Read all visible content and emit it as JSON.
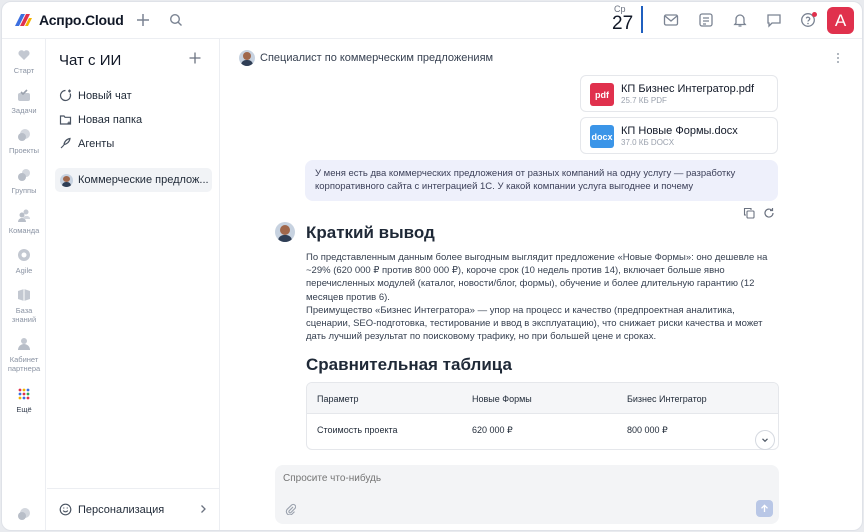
{
  "app": {
    "logo_text": "Аспро.Cloud",
    "brand_colors": [
      "#3c6fe0",
      "#e0314d",
      "#f4b400"
    ],
    "date": {
      "weekday": "Ср",
      "day": "27"
    },
    "user_initial": "А"
  },
  "rail": [
    {
      "label": "Старт",
      "icon": "heart-icon"
    },
    {
      "label": "Задачи",
      "icon": "tasks-icon"
    },
    {
      "label": "Проекты",
      "icon": "projects-icon"
    },
    {
      "label": "Группы",
      "icon": "groups-icon"
    },
    {
      "label": "Команда",
      "icon": "team-icon"
    },
    {
      "label": "Agile",
      "icon": "agile-icon"
    },
    {
      "label": "База знаний",
      "icon": "knowledge-icon"
    },
    {
      "label": "Кабинет партнера",
      "icon": "partner-icon"
    },
    {
      "label": "Ещё",
      "icon": "grid-icon"
    }
  ],
  "sidebar": {
    "title": "Чат с ИИ",
    "links": [
      {
        "label": "Новый чат",
        "icon": "new-chat-icon"
      },
      {
        "label": "Новая папка",
        "icon": "new-folder-icon"
      },
      {
        "label": "Агенты",
        "icon": "agents-icon"
      }
    ],
    "chats": [
      {
        "label": "Коммерческие предлож..."
      }
    ],
    "footer": {
      "label": "Персонализация"
    }
  },
  "chat": {
    "header": "Специалист по коммерческим предложениям",
    "files": [
      {
        "badge": "pdf",
        "badge_color": "#e0314d",
        "name": "КП Бизнес Интегратор.pdf",
        "meta": "25.7 КБ PDF"
      },
      {
        "badge": "docx",
        "badge_color": "#3b95e8",
        "name": "КП Новые Формы.docx",
        "meta": "37.0 КБ DOCX"
      }
    ],
    "user_message": "У меня есть два коммерческих предложения от разных компаний на одну услугу — разработку корпоративного сайта с интеграцией 1С. У какой компании услуга выгоднее и почему",
    "answer": {
      "heading": "Краткий вывод",
      "paragraph1": "По представленным данным более выгодным выглядит предложение «Новые Формы»: оно дешевле на ~29% (620 000 ₽ против 800 000 ₽), короче срок (10 недель против 14), включает больше явно перечисленных модулей (каталог, новости/блог, формы), обучение и более длительную гарантию (12 месяцев против 6).",
      "paragraph2": "Преимущество «Бизнес Интегратора» — упор на процесс и качество (предпроектная аналитика, сценарии, SEO-подготовка, тестирование и ввод в эксплуатацию), что снижает риски качества и может дать лучший результат по поисковому трафику, но при большей цене и сроках.",
      "table_heading": "Сравнительная таблица",
      "table": {
        "columns": [
          "Параметр",
          "Новые Формы",
          "Бизнес Интегратор"
        ],
        "rows": [
          [
            "Стоимость проекта",
            "620 000 ₽",
            "800 000 ₽"
          ]
        ]
      }
    },
    "composer_placeholder": "Спросите что-нибудь"
  }
}
